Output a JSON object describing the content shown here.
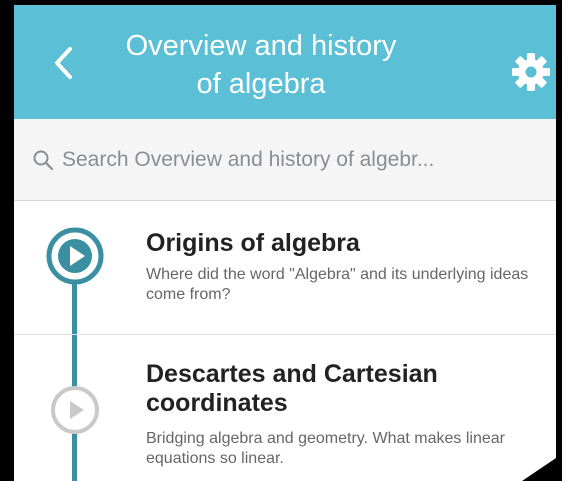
{
  "header": {
    "title": "Overview and history of algebra",
    "back_icon": "chevron-left-icon",
    "settings_icon": "gear-icon",
    "background_color": "#5bbfd6"
  },
  "search": {
    "icon": "search-icon",
    "placeholder": "Search Overview and history of algebr..."
  },
  "lessons": [
    {
      "title": "Origins of algebra",
      "description": "Where did the word \"Algebra\" and its underlying ideas come from?",
      "status_icon": "play-circle-active-icon"
    },
    {
      "title": "Descartes and Cartesian coordinates",
      "description": "Bridging algebra and geometry.  What makes linear equations so linear.",
      "status_icon": "play-circle-inactive-icon"
    }
  ],
  "colors": {
    "accent": "#3a8fa3",
    "inactive_node": "#c9c9cb"
  }
}
